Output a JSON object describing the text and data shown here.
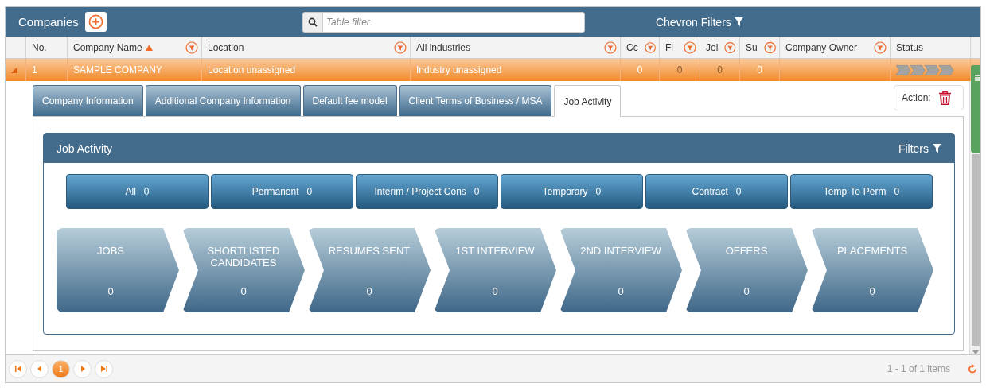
{
  "header": {
    "title": "Companies",
    "search": {
      "placeholder": "Table filter"
    },
    "chevron_filters": "Chevron Filters"
  },
  "table": {
    "columns": [
      {
        "label": "No.",
        "sorted": false,
        "filter": false
      },
      {
        "label": "Company Name",
        "sorted": true,
        "filter": true
      },
      {
        "label": "Location",
        "sorted": false,
        "filter": true
      },
      {
        "label": "All industries",
        "sorted": false,
        "filter": true
      },
      {
        "label": "Cc",
        "sorted": false,
        "filter": true
      },
      {
        "label": "Fl",
        "sorted": false,
        "filter": true
      },
      {
        "label": "Jol",
        "sorted": false,
        "filter": true
      },
      {
        "label": "Su",
        "sorted": false,
        "filter": true
      },
      {
        "label": "Company Owner",
        "sorted": false,
        "filter": true
      },
      {
        "label": "Status",
        "sorted": false,
        "filter": false
      }
    ],
    "rows": [
      {
        "selected": true,
        "expanded": true,
        "cells": [
          {
            "text": "1",
            "muted": false
          },
          {
            "text": "SAMPLE COMPANY",
            "muted": false
          },
          {
            "text": "Location unassigned",
            "muted": false
          },
          {
            "text": "Industry unassigned",
            "muted": false
          },
          {
            "text": "0",
            "muted": false
          },
          {
            "text": "0",
            "muted": true
          },
          {
            "text": "0",
            "muted": true
          },
          {
            "text": "0",
            "muted": false
          }
        ]
      }
    ]
  },
  "tabs": [
    {
      "label": "Company Information",
      "selected": false
    },
    {
      "label": "Additional Company Information",
      "selected": false
    },
    {
      "label": "Default fee model",
      "selected": false
    },
    {
      "label": "Client Terms of Business / MSA",
      "selected": false
    },
    {
      "label": "Job Activity",
      "selected": true
    }
  ],
  "action": {
    "label": "Action:"
  },
  "job_activity": {
    "title": "Job Activity",
    "filters": "Filters",
    "types": [
      {
        "label": "All",
        "count": "0"
      },
      {
        "label": "Permanent",
        "count": "0"
      },
      {
        "label": "Interim / Project Cons",
        "count": "0"
      },
      {
        "label": "Temporary",
        "count": "0"
      },
      {
        "label": "Contract",
        "count": "0"
      },
      {
        "label": "Temp-To-Perm",
        "count": "0"
      }
    ],
    "stages": [
      {
        "label": "JOBS",
        "count": "0"
      },
      {
        "label": "SHORTLISTED CANDIDATES",
        "count": "0"
      },
      {
        "label": "RESUMES SENT",
        "count": "0"
      },
      {
        "label": "1ST INTERVIEW",
        "count": "0"
      },
      {
        "label": "2ND INTERVIEW",
        "count": "0"
      },
      {
        "label": "OFFERS",
        "count": "0"
      },
      {
        "label": "PLACEMENTS",
        "count": "0"
      }
    ]
  },
  "pager": {
    "pages": [
      {
        "label": "1",
        "selected": true
      }
    ],
    "info": "1 - 1 of 1 items"
  }
}
